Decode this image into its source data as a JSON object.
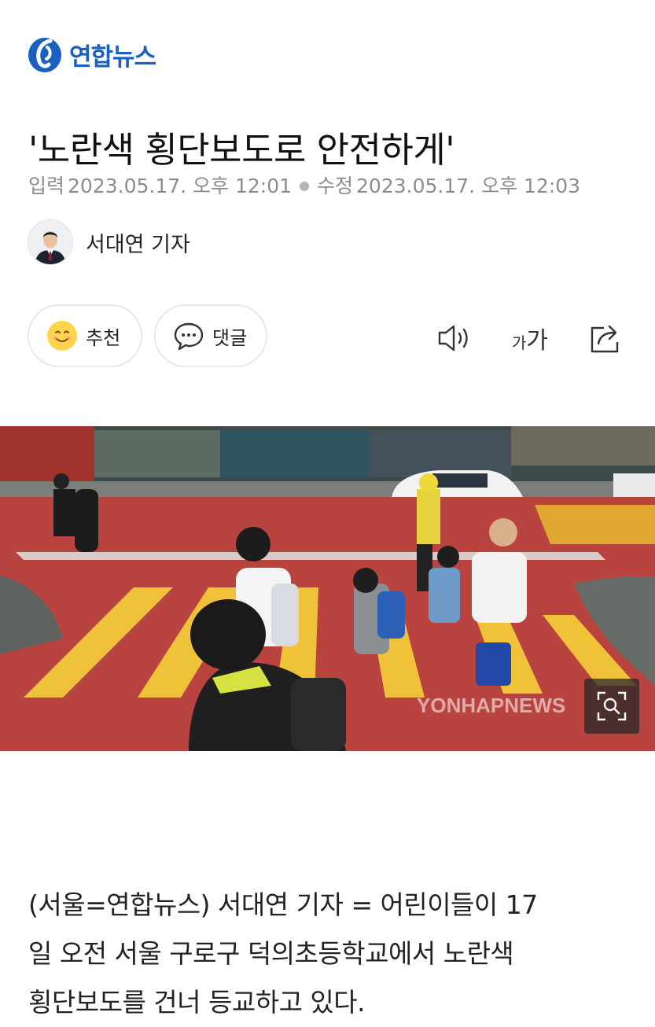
{
  "header": {
    "brand": "연합뉴스"
  },
  "article": {
    "title": "'노란색 횡단보도로 안전하게'",
    "input_label": "입력",
    "input_time": "2023.05.17. 오후 12:01",
    "edit_label": "수정",
    "edit_time": "2023.05.17. 오후 12:03",
    "reporter": "서대연 기자",
    "body_lines": [
      "(서울=연합뉴스) 서대연 기자 = 어린이들이 17",
      "일 오전 서울 구로구 덕의초등학교에서 노란색",
      "횡단보도를 건너 등교하고 있다."
    ]
  },
  "actions": {
    "like_label": "추천",
    "comment_label": "댓글",
    "font_small": "가",
    "font_large": "가"
  },
  "photo": {
    "watermark": "YONHAPNEWS"
  },
  "icons": {
    "logo": "yonhap-logo-icon",
    "like": "smiley-icon",
    "comment": "speech-bubble-icon",
    "tts": "speaker-icon",
    "font": "font-size-icon",
    "share": "share-icon",
    "zoom": "zoom-icon"
  },
  "colors": {
    "brand": "#1b5fbf",
    "smiley": "#ffd34d",
    "meta_gray": "#8c8c8c"
  }
}
